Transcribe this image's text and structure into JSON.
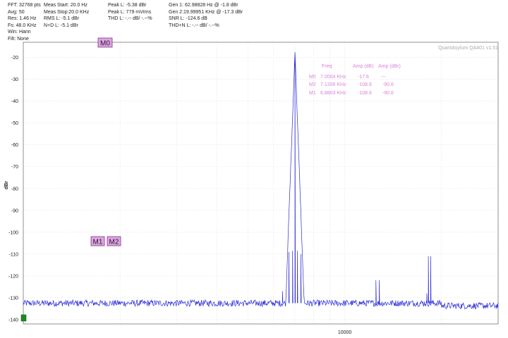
{
  "header": {
    "col1": [
      "FFT: 32768 pts",
      "Avg: 50",
      "Res: 1.46 Hz",
      "Fs: 48.0 KHz",
      "Win: Hann",
      "Filt: None"
    ],
    "col2": [
      "Meas Start: 20.0 Hz",
      "Meas Stop:20.0 KHz",
      "RMS L: -5.1 dBr",
      "",
      "N+D L: -5.1 dBr"
    ],
    "col3": [
      "Peak L: -5.38 dBr",
      "",
      "Peak L: 779 mVrms",
      "",
      "THD L: -.-- dB/ -.--%"
    ],
    "col4": [
      "Gen 1: 62.98828 Hz @ -1.8  dBr",
      "Gen 2:19.99951 KHz @ -17.3  dBr",
      "SNR L: -124.6 dB",
      "",
      "THD+N L: -.-- dB/ -.--%"
    ]
  },
  "watermark": "QuantAsylum QA401 v1.51",
  "marker_table": {
    "headers": [
      "Freq",
      "Amp (dB)",
      "Amp (dBr)"
    ],
    "rows": [
      {
        "name": "M0",
        "freq": "7.0004 KHz",
        "amp_db": "-17.6",
        "amp_dbr": "---"
      },
      {
        "name": "M2",
        "freq": "7.1206 KHz",
        "amp_db": "-108.6",
        "amp_dbr": "-90.6"
      },
      {
        "name": "M1",
        "freq": "6.8803 KHz",
        "amp_db": "-108.6",
        "amp_dbr": "-90.6"
      }
    ]
  },
  "markers": {
    "m0": "M0",
    "m1": "M1",
    "m2": "M2"
  },
  "colors": {
    "trace": "#2b2bd6",
    "marker_fill": "#e0a3e6",
    "marker_table": "#d884dd",
    "grid": "#d8d8d8",
    "indicator": "#1e8a1e"
  },
  "chart_data": {
    "type": "line",
    "title": "",
    "xlabel": "",
    "ylabel": "dBr",
    "x_scale": "log",
    "x_tick_labels": [
      "10000"
    ],
    "y_ticks": [
      -20,
      -30,
      -40,
      -50,
      -60,
      -70,
      -80,
      -90,
      -100,
      -110,
      -120,
      -130,
      -140
    ],
    "ylim": [
      -142,
      -13
    ],
    "grid": true,
    "noise_floor_dbr": -132.5,
    "series": [
      {
        "points_hz_dbr": [
          [
            7000,
            -17.6
          ],
          [
            6880,
            -108.6
          ],
          [
            7120,
            -108.6
          ],
          [
            6700,
            -109
          ],
          [
            7300,
            -110
          ],
          [
            6400,
            -127
          ],
          [
            12500,
            -122
          ],
          [
            12800,
            -122
          ],
          [
            18200,
            -111
          ],
          [
            18500,
            -111
          ],
          [
            18000,
            -128
          ]
        ]
      }
    ]
  }
}
